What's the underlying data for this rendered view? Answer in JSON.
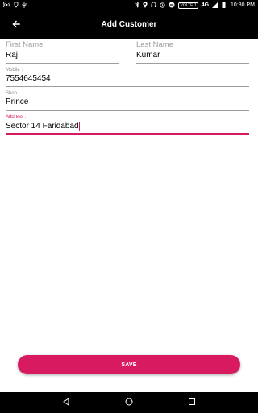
{
  "status_bar": {
    "time": "10:30 PM",
    "volte_badge": "VOLTE 1",
    "network": "4G"
  },
  "app_bar": {
    "title": "Add Customer"
  },
  "form": {
    "first_name": {
      "label": "First Name",
      "value": "Raj"
    },
    "last_name": {
      "label": "Last Name",
      "value": "Kumar"
    },
    "mobile": {
      "label": "Mobile :",
      "value": "7554645454"
    },
    "shop": {
      "label": "Shop :",
      "value": "Prince"
    },
    "address": {
      "label": "Address :",
      "value": "Sector 14 Faridabad"
    }
  },
  "actions": {
    "save_label": "SAVE"
  },
  "colors": {
    "accent": "#d81b60",
    "bar": "#000000"
  }
}
